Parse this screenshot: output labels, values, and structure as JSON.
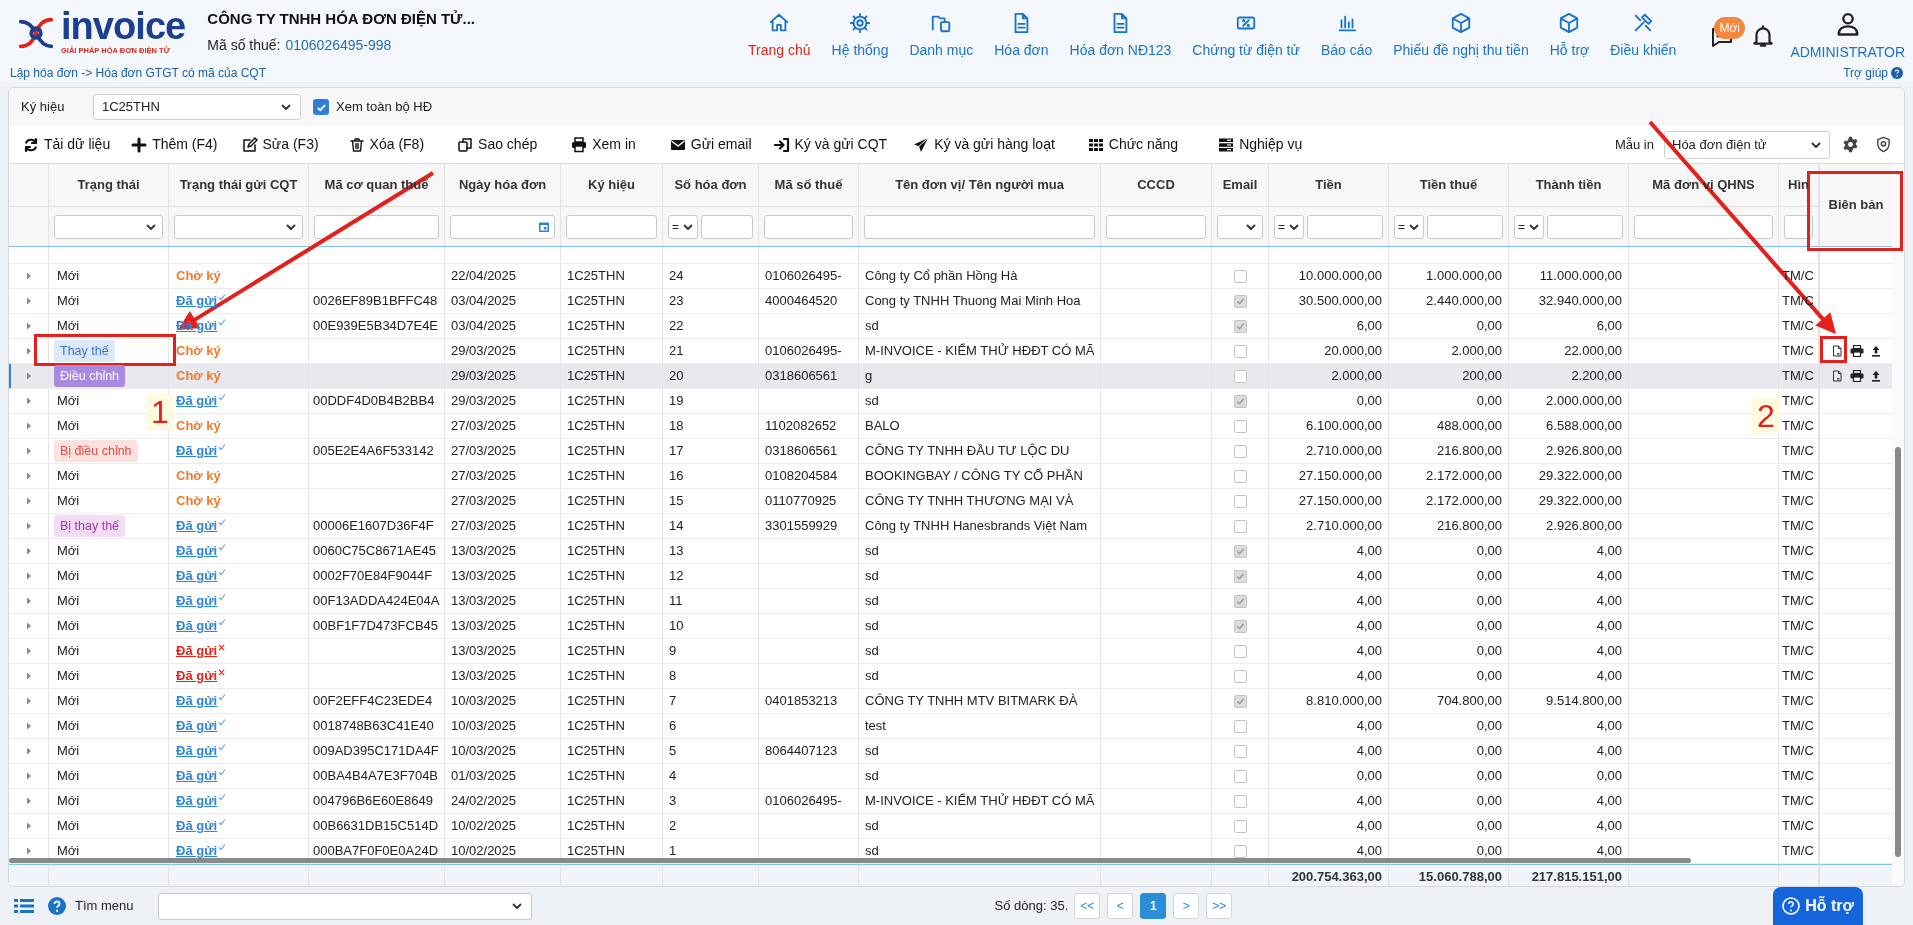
{
  "header": {
    "logo_text": "invoice",
    "logo_tagline": "GIẢI PHÁP HÓA ĐƠN ĐIỆN TỬ",
    "company": "CÔNG TY TNHH HÓA ĐƠN ĐIỆN TỬ...",
    "tax_label": "Mã số thuế:",
    "tax_code": "0106026495-998",
    "breadcrumb": "Lập hóa đơn -> Hóa đơn GTGT có mã của CQT",
    "nav": [
      {
        "label": "Trang chủ",
        "selected": true
      },
      {
        "label": "Hệ thống",
        "selected": false
      },
      {
        "label": "Danh mục",
        "selected": false
      },
      {
        "label": "Hóa đơn",
        "selected": false
      },
      {
        "label": "Hóa đơn NĐ123",
        "selected": false
      },
      {
        "label": "Chứng từ điện tử",
        "selected": false
      },
      {
        "label": "Báo cáo",
        "selected": false
      },
      {
        "label": "Phiếu đề nghị thu tiền",
        "selected": false
      },
      {
        "label": "Hỗ trợ",
        "selected": false
      },
      {
        "label": "Điều khiển",
        "selected": false
      }
    ],
    "message_badge": "Mới",
    "user": "ADMINISTRATOR",
    "help": "Trợ giúp"
  },
  "symbol_filter": {
    "label": "Ký hiệu",
    "value": "1C25THN"
  },
  "view_all": {
    "label": "Xem toàn bộ HĐ",
    "checked": true
  },
  "toolbar": [
    "Tải dữ liệu",
    "Thêm (F4)",
    "Sửa (F3)",
    "Xóa (F8)",
    "Sao chép",
    "Xem in",
    "Gửi email",
    "Ký và gửi CQT",
    "Ký và gửi hàng loạt",
    "Chức năng",
    "Nghiệp vụ"
  ],
  "print_template": {
    "label": "Mẫu in",
    "value": "Hóa đơn điện tử"
  },
  "table": {
    "columns": [
      {
        "label": "Trạng thái",
        "kind": "select"
      },
      {
        "label": "Trạng thái gửi CQT",
        "kind": "select"
      },
      {
        "label": "Mã cơ quan thuế",
        "kind": "text"
      },
      {
        "label": "Ngày hóa đơn",
        "kind": "date"
      },
      {
        "label": "Ký hiệu",
        "kind": "text"
      },
      {
        "label": "Số hóa đơn",
        "kind": "compare",
        "operator": "="
      },
      {
        "label": "Mã số thuế",
        "kind": "text"
      },
      {
        "label": "Tên đơn vị/ Tên người mua",
        "kind": "text"
      },
      {
        "label": "CCCD",
        "kind": "text"
      },
      {
        "label": "Email",
        "kind": "select"
      },
      {
        "label": "Tiền",
        "kind": "compare",
        "operator": "="
      },
      {
        "label": "Tiền thuế",
        "kind": "compare",
        "operator": "="
      },
      {
        "label": "Thành tiền",
        "kind": "compare",
        "operator": "="
      },
      {
        "label": "Mã đơn vị QHNS",
        "kind": "text"
      },
      {
        "label": "Hìn",
        "kind": "text"
      }
    ],
    "actions_column": "Biên bản",
    "rows": [
      {
        "status": {
          "label": "Mới",
          "kind": "new"
        },
        "cqt": {
          "label": "Chờ ký",
          "kind": "pending"
        },
        "date": "22/04/2025",
        "symbol": "1C25THN",
        "number": "24",
        "tax_id": "0106026495-",
        "buyer": "Công ty Cổ phần Hồng Hà",
        "email_checked": false,
        "amount": "10.000.000,00",
        "tax": "1.000.000,00",
        "total": "11.000.000,00",
        "form": "TM/C",
        "has_actions": false,
        "selected": false
      },
      {
        "status": {
          "label": "Mới",
          "kind": "new"
        },
        "cqt": {
          "label": "Đã gửi",
          "kind": "sent"
        },
        "code": "0026EF89B1BFFC48",
        "date": "03/04/2025",
        "symbol": "1C25THN",
        "number": "23",
        "tax_id": "4000464520",
        "buyer": "Cong ty TNHH Thuong Mai Minh Hoa",
        "email_checked": true,
        "amount": "30.500.000,00",
        "tax": "2.440.000,00",
        "total": "32.940.000,00",
        "form": "TM/C",
        "has_actions": false,
        "selected": false
      },
      {
        "status": {
          "label": "Mới",
          "kind": "new"
        },
        "cqt": {
          "label": "Đã gửi",
          "kind": "sent"
        },
        "code": "00E939E5B34D7E4E",
        "date": "03/04/2025",
        "symbol": "1C25THN",
        "number": "22",
        "buyer": "sd",
        "email_checked": true,
        "amount": "6,00",
        "tax": "0,00",
        "total": "6,00",
        "form": "TM/C",
        "has_actions": false,
        "selected": false
      },
      {
        "status": {
          "label": "Thay thế",
          "kind": "replacement"
        },
        "cqt": {
          "label": "Chờ ký",
          "kind": "pending"
        },
        "date": "29/03/2025",
        "symbol": "1C25THN",
        "number": "21",
        "tax_id": "0106026495-",
        "buyer": "M-INVOICE - KIỂM THỬ HĐĐT CÓ MÃ",
        "email_checked": false,
        "amount": "20.000,00",
        "tax": "2.000,00",
        "total": "22.000,00",
        "form": "TM/C",
        "has_actions": true,
        "selected": false
      },
      {
        "status": {
          "label": "Điều chỉnh",
          "kind": "adjustment"
        },
        "cqt": {
          "label": "Chờ ký",
          "kind": "pending"
        },
        "date": "29/03/2025",
        "symbol": "1C25THN",
        "number": "20",
        "tax_id": "0318606561",
        "buyer": "g",
        "email_checked": false,
        "amount": "2.000,00",
        "tax": "200,00",
        "total": "2.200,00",
        "form": "TM/C",
        "has_actions": true,
        "selected": true
      },
      {
        "status": {
          "label": "Mới",
          "kind": "new"
        },
        "cqt": {
          "label": "Đã gửi",
          "kind": "sent"
        },
        "code": "00DDF4D0B4B2BB4",
        "date": "29/03/2025",
        "symbol": "1C25THN",
        "number": "19",
        "buyer": "sd",
        "email_checked": true,
        "amount": "0,00",
        "tax": "0,00",
        "total": "2.000.000,00",
        "form": "TM/C",
        "has_actions": false,
        "selected": false
      },
      {
        "status": {
          "label": "Mới",
          "kind": "new"
        },
        "cqt": {
          "label": "Chờ ký",
          "kind": "pending"
        },
        "date": "27/03/2025",
        "symbol": "1C25THN",
        "number": "18",
        "tax_id": "1102082652",
        "buyer": "BALO",
        "email_checked": false,
        "amount": "6.100.000,00",
        "tax": "488.000,00",
        "total": "6.588.000,00",
        "form": "TM/C",
        "has_actions": false,
        "selected": false
      },
      {
        "status": {
          "label": "Bị điều chỉnh",
          "kind": "adjusted"
        },
        "cqt": {
          "label": "Đã gửi",
          "kind": "sent"
        },
        "code": "005E2E4A6F533142",
        "date": "27/03/2025",
        "symbol": "1C25THN",
        "number": "17",
        "tax_id": "0318606561",
        "buyer": "CÔNG TY TNHH ĐẦU TƯ LỘC DU",
        "email_checked": false,
        "amount": "2.710.000,00",
        "tax": "216.800,00",
        "total": "2.926.800,00",
        "form": "TM/C",
        "has_actions": false,
        "selected": false
      },
      {
        "status": {
          "label": "Mới",
          "kind": "new"
        },
        "cqt": {
          "label": "Chờ ký",
          "kind": "pending"
        },
        "date": "27/03/2025",
        "symbol": "1C25THN",
        "number": "16",
        "tax_id": "0108204584",
        "buyer": "BOOKINGBAY / CÔNG TY CỔ PHẦN",
        "email_checked": false,
        "amount": "27.150.000,00",
        "tax": "2.172.000,00",
        "total": "29.322.000,00",
        "form": "TM/C",
        "has_actions": false,
        "selected": false
      },
      {
        "status": {
          "label": "Mới",
          "kind": "new"
        },
        "cqt": {
          "label": "Chờ ký",
          "kind": "pending"
        },
        "date": "27/03/2025",
        "symbol": "1C25THN",
        "number": "15",
        "tax_id": "0110770925",
        "buyer": "CÔNG TY TNHH THƯƠNG MẠI VÀ",
        "email_checked": false,
        "amount": "27.150.000,00",
        "tax": "2.172.000,00",
        "total": "29.322.000,00",
        "form": "TM/C",
        "has_actions": false,
        "selected": false
      },
      {
        "status": {
          "label": "Bị thay thế",
          "kind": "replaced"
        },
        "cqt": {
          "label": "Đã gửi",
          "kind": "sent"
        },
        "code": "00006E1607D36F4F",
        "date": "27/03/2025",
        "symbol": "1C25THN",
        "number": "14",
        "tax_id": "3301559929",
        "buyer": "Công ty TNHH Hanesbrands Việt Nam",
        "email_checked": false,
        "amount": "2.710.000,00",
        "tax": "216.800,00",
        "total": "2.926.800,00",
        "form": "TM/C",
        "has_actions": false,
        "selected": false
      },
      {
        "status": {
          "label": "Mới",
          "kind": "new"
        },
        "cqt": {
          "label": "Đã gửi",
          "kind": "sent"
        },
        "code": "0060C75C8671AE45",
        "date": "13/03/2025",
        "symbol": "1C25THN",
        "number": "13",
        "buyer": "sd",
        "email_checked": true,
        "amount": "4,00",
        "tax": "0,00",
        "total": "4,00",
        "form": "TM/C",
        "has_actions": false,
        "selected": false
      },
      {
        "status": {
          "label": "Mới",
          "kind": "new"
        },
        "cqt": {
          "label": "Đã gửi",
          "kind": "sent"
        },
        "code": "0002F70E84F9044F",
        "date": "13/03/2025",
        "symbol": "1C25THN",
        "number": "12",
        "buyer": "sd",
        "email_checked": true,
        "amount": "4,00",
        "tax": "0,00",
        "total": "4,00",
        "form": "TM/C",
        "has_actions": false,
        "selected": false
      },
      {
        "status": {
          "label": "Mới",
          "kind": "new"
        },
        "cqt": {
          "label": "Đã gửi",
          "kind": "sent"
        },
        "code": "00F13ADDA424E04A",
        "date": "13/03/2025",
        "symbol": "1C25THN",
        "number": "11",
        "buyer": "sd",
        "email_checked": true,
        "amount": "4,00",
        "tax": "0,00",
        "total": "4,00",
        "form": "TM/C",
        "has_actions": false,
        "selected": false
      },
      {
        "status": {
          "label": "Mới",
          "kind": "new"
        },
        "cqt": {
          "label": "Đã gửi",
          "kind": "sent"
        },
        "code": "00BF1F7D473FCB45",
        "date": "13/03/2025",
        "symbol": "1C25THN",
        "number": "10",
        "buyer": "sd",
        "email_checked": true,
        "amount": "4,00",
        "tax": "0,00",
        "total": "4,00",
        "form": "TM/C",
        "has_actions": false,
        "selected": false
      },
      {
        "status": {
          "label": "Mới",
          "kind": "new"
        },
        "cqt": {
          "label": "Đã gửi",
          "kind": "failed"
        },
        "date": "13/03/2025",
        "symbol": "1C25THN",
        "number": "9",
        "buyer": "sd",
        "email_checked": false,
        "amount": "4,00",
        "tax": "0,00",
        "total": "4,00",
        "form": "TM/C",
        "has_actions": false,
        "selected": false
      },
      {
        "status": {
          "label": "Mới",
          "kind": "new"
        },
        "cqt": {
          "label": "Đã gửi",
          "kind": "failed"
        },
        "date": "13/03/2025",
        "symbol": "1C25THN",
        "number": "8",
        "buyer": "sd",
        "email_checked": false,
        "amount": "4,00",
        "tax": "0,00",
        "total": "4,00",
        "form": "TM/C",
        "has_actions": false,
        "selected": false
      },
      {
        "status": {
          "label": "Mới",
          "kind": "new"
        },
        "cqt": {
          "label": "Đã gửi",
          "kind": "sent"
        },
        "code": "00F2EFF4C23EDE4",
        "date": "10/03/2025",
        "symbol": "1C25THN",
        "number": "7",
        "tax_id": "0401853213",
        "buyer": "CÔNG TY TNHH MTV BITMARK ĐÀ",
        "email_checked": true,
        "amount": "8.810.000,00",
        "tax": "704.800,00",
        "total": "9.514.800,00",
        "form": "TM/C",
        "has_actions": false,
        "selected": false
      },
      {
        "status": {
          "label": "Mới",
          "kind": "new"
        },
        "cqt": {
          "label": "Đã gửi",
          "kind": "sent"
        },
        "code": "0018748B63C41E40",
        "date": "10/03/2025",
        "symbol": "1C25THN",
        "number": "6",
        "buyer": "test",
        "email_checked": false,
        "amount": "4,00",
        "tax": "0,00",
        "total": "4,00",
        "form": "TM/C",
        "has_actions": false,
        "selected": false
      },
      {
        "status": {
          "label": "Mới",
          "kind": "new"
        },
        "cqt": {
          "label": "Đã gửi",
          "kind": "sent"
        },
        "code": "009AD395C171DA4F",
        "date": "10/03/2025",
        "symbol": "1C25THN",
        "number": "5",
        "tax_id": "8064407123",
        "buyer": "sd",
        "email_checked": false,
        "amount": "4,00",
        "tax": "0,00",
        "total": "4,00",
        "form": "TM/C",
        "has_actions": false,
        "selected": false
      },
      {
        "status": {
          "label": "Mới",
          "kind": "new"
        },
        "cqt": {
          "label": "Đã gửi",
          "kind": "sent"
        },
        "code": "00BA4B4A7E3F704B",
        "date": "01/03/2025",
        "symbol": "1C25THN",
        "number": "4",
        "buyer": "sd",
        "email_checked": false,
        "amount": "0,00",
        "tax": "0,00",
        "total": "0,00",
        "form": "TM/C",
        "has_actions": false,
        "selected": false
      },
      {
        "status": {
          "label": "Mới",
          "kind": "new"
        },
        "cqt": {
          "label": "Đã gửi",
          "kind": "sent"
        },
        "code": "004796B6E60E8649",
        "date": "24/02/2025",
        "symbol": "1C25THN",
        "number": "3",
        "tax_id": "0106026495-",
        "buyer": "M-INVOICE - KIỂM THỬ HĐĐT CÓ MÃ",
        "email_checked": false,
        "amount": "4,00",
        "tax": "0,00",
        "total": "4,00",
        "form": "TM/C",
        "has_actions": false,
        "selected": false
      },
      {
        "status": {
          "label": "Mới",
          "kind": "new"
        },
        "cqt": {
          "label": "Đã gửi",
          "kind": "sent"
        },
        "code": "00B6631DB15C514D",
        "date": "10/02/2025",
        "symbol": "1C25THN",
        "number": "2",
        "buyer": "sd",
        "email_checked": false,
        "amount": "4,00",
        "tax": "0,00",
        "total": "4,00",
        "form": "TM/C",
        "has_actions": false,
        "selected": false
      },
      {
        "status": {
          "label": "Mới",
          "kind": "new"
        },
        "cqt": {
          "label": "Đã gửi",
          "kind": "sent"
        },
        "code": "000BA7F0F0E0A24D",
        "date": "10/02/2025",
        "symbol": "1C25THN",
        "number": "1",
        "buyer": "sd",
        "email_checked": false,
        "amount": "4,00",
        "tax": "0,00",
        "total": "4,00",
        "form": "TM/C",
        "has_actions": false,
        "selected": false
      }
    ],
    "totals": {
      "amount": "200.754.363,00",
      "tax": "15.060.788,00",
      "total": "217.815.151,00"
    }
  },
  "footer": {
    "menu_search_label": "Tìm menu",
    "row_count": "Số dòng: 35.",
    "pages": [
      {
        "label": "<<",
        "selected": false
      },
      {
        "label": "<",
        "selected": false
      },
      {
        "label": "1",
        "selected": true
      },
      {
        "label": ">",
        "selected": false
      },
      {
        "label": ">>",
        "selected": false
      }
    ],
    "support": "Hỗ trợ"
  },
  "callouts": [
    {
      "label": "1"
    },
    {
      "label": "2"
    }
  ]
}
